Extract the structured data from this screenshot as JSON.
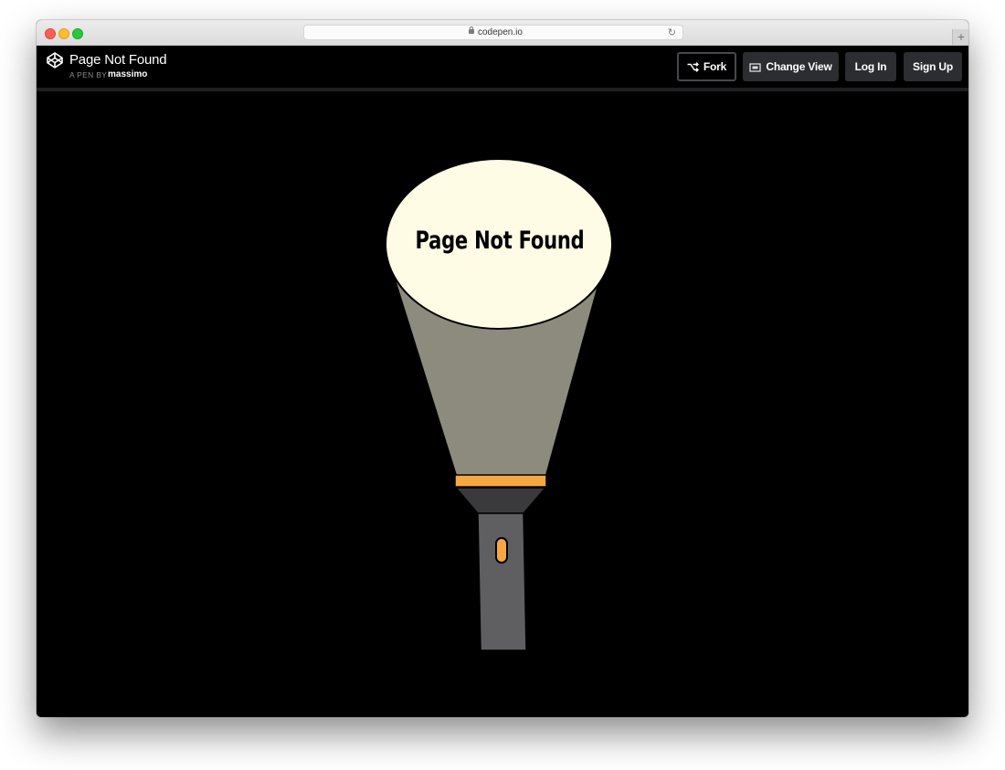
{
  "browser": {
    "url": "codepen.io",
    "reload_icon": "reload-icon",
    "new_tab_icon": "plus-icon",
    "new_tab_glyph": "+"
  },
  "pen": {
    "title": "Page Not Found",
    "by_label": "A PEN BY",
    "author": "massimo",
    "logo_icon": "codepen-logo-icon"
  },
  "toolbar": {
    "fork_label": "Fork",
    "change_view_label": "Change View",
    "login_label": "Log In",
    "signup_label": "Sign Up"
  },
  "content": {
    "message": "Page Not Found"
  },
  "colors": {
    "light_beam": "#fefce5",
    "beam_cone": "#8c8b7e",
    "bezel": "#f5a742",
    "flashlight_body": "#5f5f62",
    "flashlight_head": "#3a3a3c",
    "background": "#000000"
  }
}
